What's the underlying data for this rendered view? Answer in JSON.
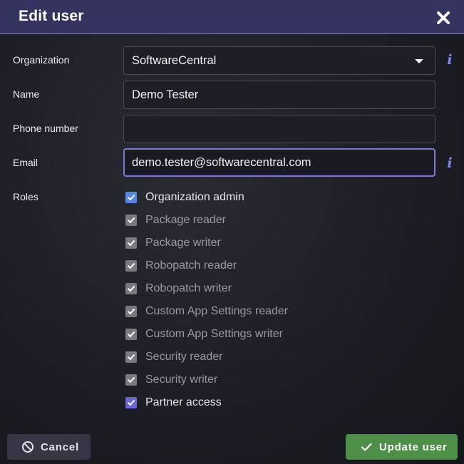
{
  "dialog": {
    "title": "Edit user",
    "close_icon": "close-icon"
  },
  "form": {
    "organization": {
      "label": "Organization",
      "value": "SoftwareCentral"
    },
    "name": {
      "label": "Name",
      "value": "Demo Tester"
    },
    "phone": {
      "label": "Phone number",
      "value": ""
    },
    "email": {
      "label": "Email",
      "value": "demo.tester@softwarecentral.com"
    },
    "info_glyph": "i",
    "roles_label": "Roles"
  },
  "roles": [
    {
      "label": "Organization admin",
      "checked": true,
      "state": "active-blue"
    },
    {
      "label": "Package reader",
      "checked": true,
      "state": "disabled"
    },
    {
      "label": "Package writer",
      "checked": true,
      "state": "disabled"
    },
    {
      "label": "Robopatch reader",
      "checked": true,
      "state": "disabled"
    },
    {
      "label": "Robopatch writer",
      "checked": true,
      "state": "disabled"
    },
    {
      "label": "Custom App Settings reader",
      "checked": true,
      "state": "disabled"
    },
    {
      "label": "Custom App Settings writer",
      "checked": true,
      "state": "disabled"
    },
    {
      "label": "Security reader",
      "checked": true,
      "state": "disabled"
    },
    {
      "label": "Security writer",
      "checked": true,
      "state": "disabled"
    },
    {
      "label": "Partner access",
      "checked": true,
      "state": "active-purple"
    }
  ],
  "footer": {
    "cancel_label": "Cancel",
    "update_label": "Update user"
  },
  "colors": {
    "header": "#35335f",
    "accent_blue": "#5689e6",
    "accent_purple": "#6b67d6",
    "update_green": "#4e8f48",
    "info_icon": "#7f8df0"
  }
}
